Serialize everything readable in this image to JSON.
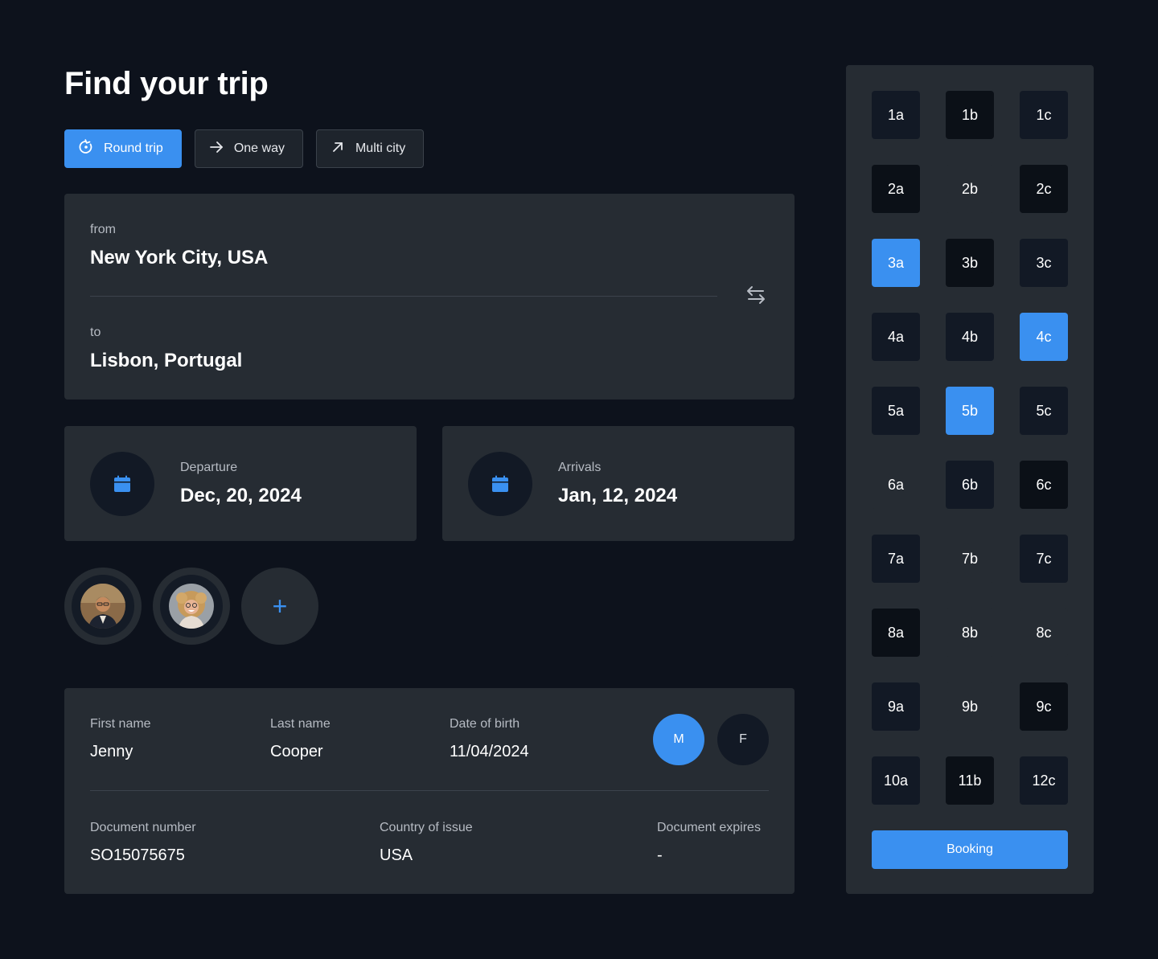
{
  "page_title": "Find your trip",
  "trip_types": [
    {
      "label": "Round trip",
      "icon": "round-trip-icon",
      "active": true
    },
    {
      "label": "One way",
      "icon": "arrow-right-icon",
      "active": false
    },
    {
      "label": "Multi city",
      "icon": "arrow-up-right-icon",
      "active": false
    }
  ],
  "route": {
    "from_label": "from",
    "from_value": "New York City, USA",
    "to_label": "to",
    "to_value": "Lisbon, Portugal",
    "swap_icon": "swap-icon"
  },
  "departure": {
    "label": "Departure",
    "value": "Dec, 20, 2024",
    "icon": "calendar-icon"
  },
  "arrival": {
    "label": "Arrivals",
    "value": "Jan, 12, 2024",
    "icon": "calendar-icon"
  },
  "passengers": {
    "avatars": [
      "avatar-man",
      "avatar-woman"
    ],
    "add_label": "+"
  },
  "passenger_form": {
    "first_name_label": "First name",
    "first_name": "Jenny",
    "last_name_label": "Last name",
    "last_name": "Cooper",
    "dob_label": "Date of birth",
    "dob": "11/04/2024",
    "gender_m": "M",
    "gender_f": "F",
    "gender_selected": "M",
    "doc_number_label": "Document number",
    "doc_number": "SO15075675",
    "country_label": "Country of issue",
    "country": "USA",
    "doc_expires_label": "Document expires",
    "doc_expires": "-"
  },
  "seats": {
    "rows": [
      [
        "1a",
        "1b",
        "1c"
      ],
      [
        "2a",
        "2b",
        "2c"
      ],
      [
        "3a",
        "3b",
        "3c"
      ],
      [
        "4a",
        "4b",
        "4c"
      ],
      [
        "5a",
        "5b",
        "5c"
      ],
      [
        "6a",
        "6b",
        "6c"
      ],
      [
        "7a",
        "7b",
        "7c"
      ],
      [
        "8a",
        "8b",
        "8c"
      ],
      [
        "9a",
        "9b",
        "9c"
      ],
      [
        "10a",
        "11b",
        "12c"
      ]
    ],
    "styles": [
      [
        "dark",
        "darker",
        "dark"
      ],
      [
        "darker",
        "lite",
        "darker"
      ],
      [
        "sel",
        "darker",
        "dark"
      ],
      [
        "dark",
        "dark",
        "sel"
      ],
      [
        "dark",
        "sel",
        "dark"
      ],
      [
        "lite",
        "dark",
        "darker"
      ],
      [
        "dark",
        "lite",
        "dark"
      ],
      [
        "darker",
        "lite",
        "lite"
      ],
      [
        "dark",
        "lite",
        "darker"
      ],
      [
        "dark",
        "darker",
        "dark"
      ]
    ],
    "selected": [
      "3a",
      "4c",
      "5b"
    ]
  },
  "booking_label": "Booking",
  "colors": {
    "accent": "#3a90f0",
    "background": "#0d121c",
    "card": "#262c33"
  }
}
